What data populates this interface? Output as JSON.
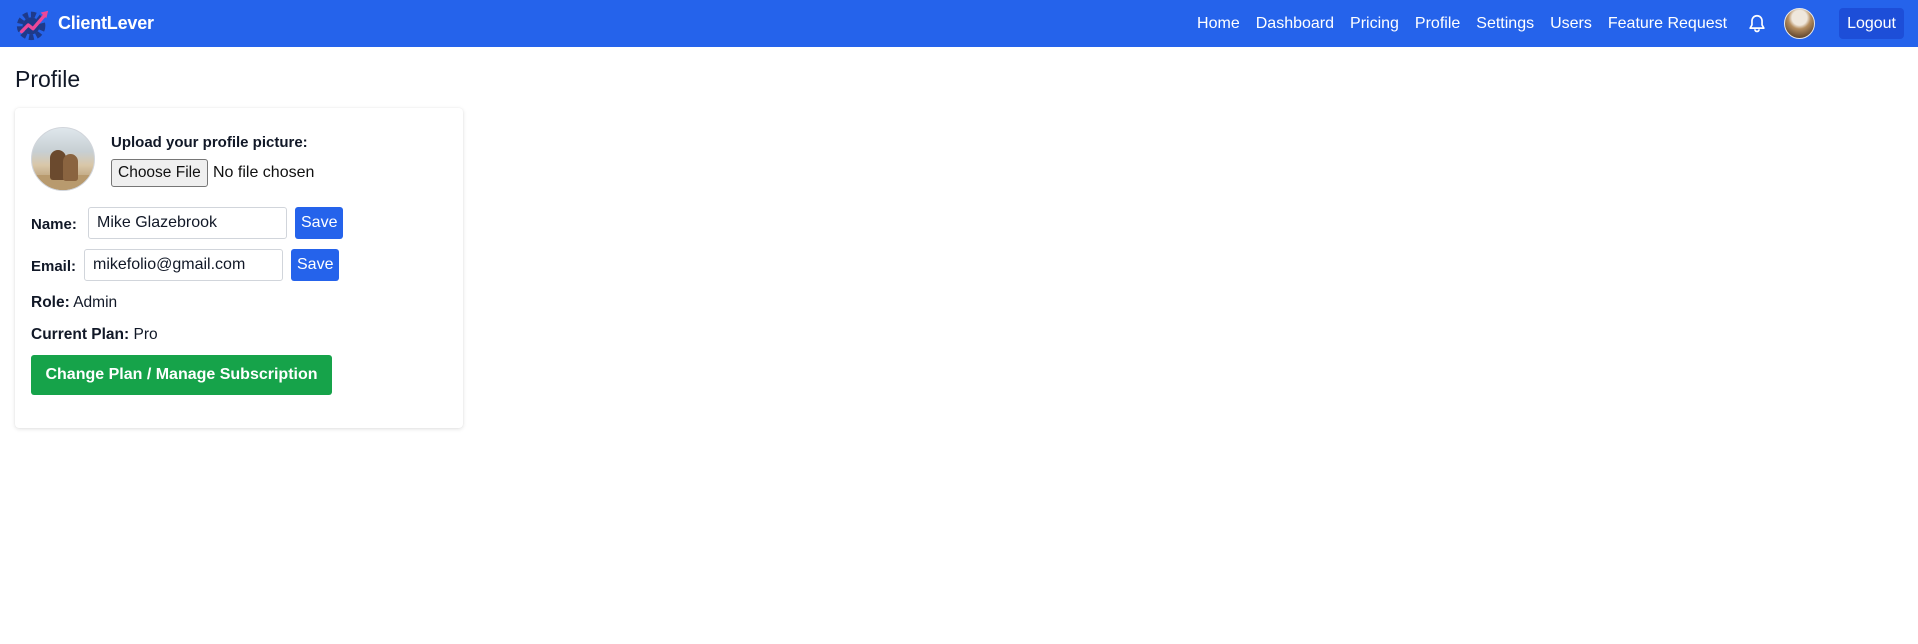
{
  "app": {
    "name": "ClientLever",
    "logo_icon": "gear-chart-logo-icon",
    "accent_color": "#2563eb"
  },
  "nav": {
    "links": [
      "Home",
      "Dashboard",
      "Pricing",
      "Profile",
      "Settings",
      "Users",
      "Feature Request"
    ],
    "notification_icon": "bell-icon",
    "logout_label": "Logout"
  },
  "page": {
    "title": "Profile"
  },
  "profile": {
    "upload_label": "Upload your profile picture:",
    "file_button_label": "Choose File",
    "file_status": "No file chosen",
    "name_label": "Name:",
    "name_value": "Mike Glazebrook",
    "email_label": "Email:",
    "email_value": "mikefolio@gmail.com",
    "save_label": "Save",
    "role_label": "Role:",
    "role_value": "Admin",
    "plan_label": "Current Plan:",
    "plan_value": "Pro",
    "plan_button_label": "Change Plan / Manage Subscription",
    "plan_button_color": "#16a34a"
  }
}
